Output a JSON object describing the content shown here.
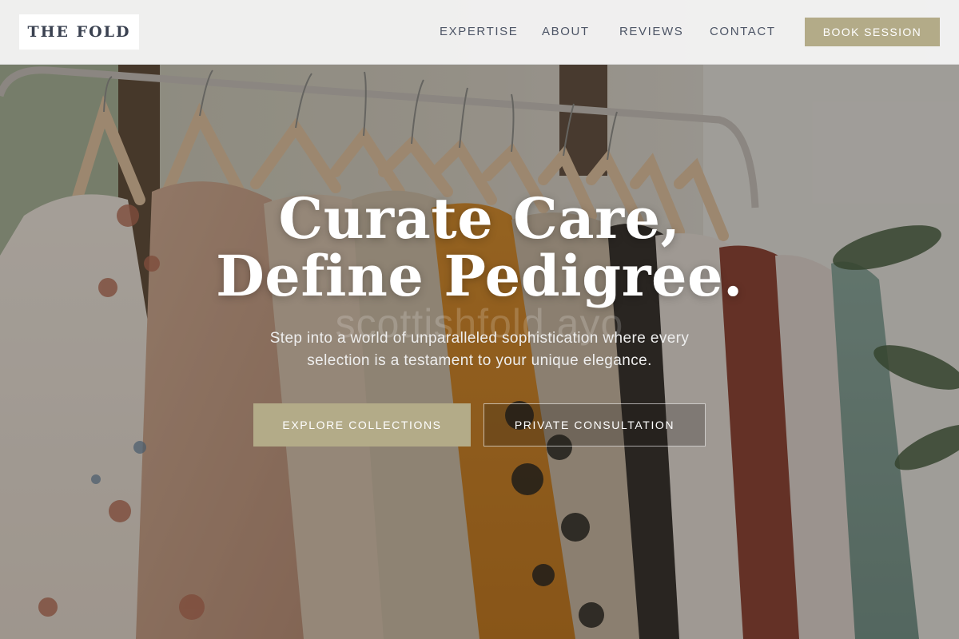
{
  "brand": {
    "logo_text": "THE FOLD"
  },
  "nav": {
    "items": [
      {
        "label": "EXPERTISE"
      },
      {
        "label": "ABOUT"
      },
      {
        "label": "REVIEWS"
      },
      {
        "label": "CONTACT"
      }
    ],
    "cta_label": "BOOK SESSION"
  },
  "hero": {
    "title_line_1": "Curate Care,",
    "title_line_2": "Define Pedigree.",
    "watermark": "scottishfold.ayo",
    "subtitle": "Step into a world of unparalleled sophistication where every selection is a testament to your unique elegance.",
    "primary_cta": "EXPLORE COLLECTIONS",
    "secondary_cta": "PRIVATE CONSULTATION",
    "background_image": "clothing-rack-photo"
  },
  "colors": {
    "accent": "#b3ab88",
    "header_bg": "#f6f6f6",
    "nav_text": "#4d5566",
    "logo_text": "#3a4150"
  }
}
